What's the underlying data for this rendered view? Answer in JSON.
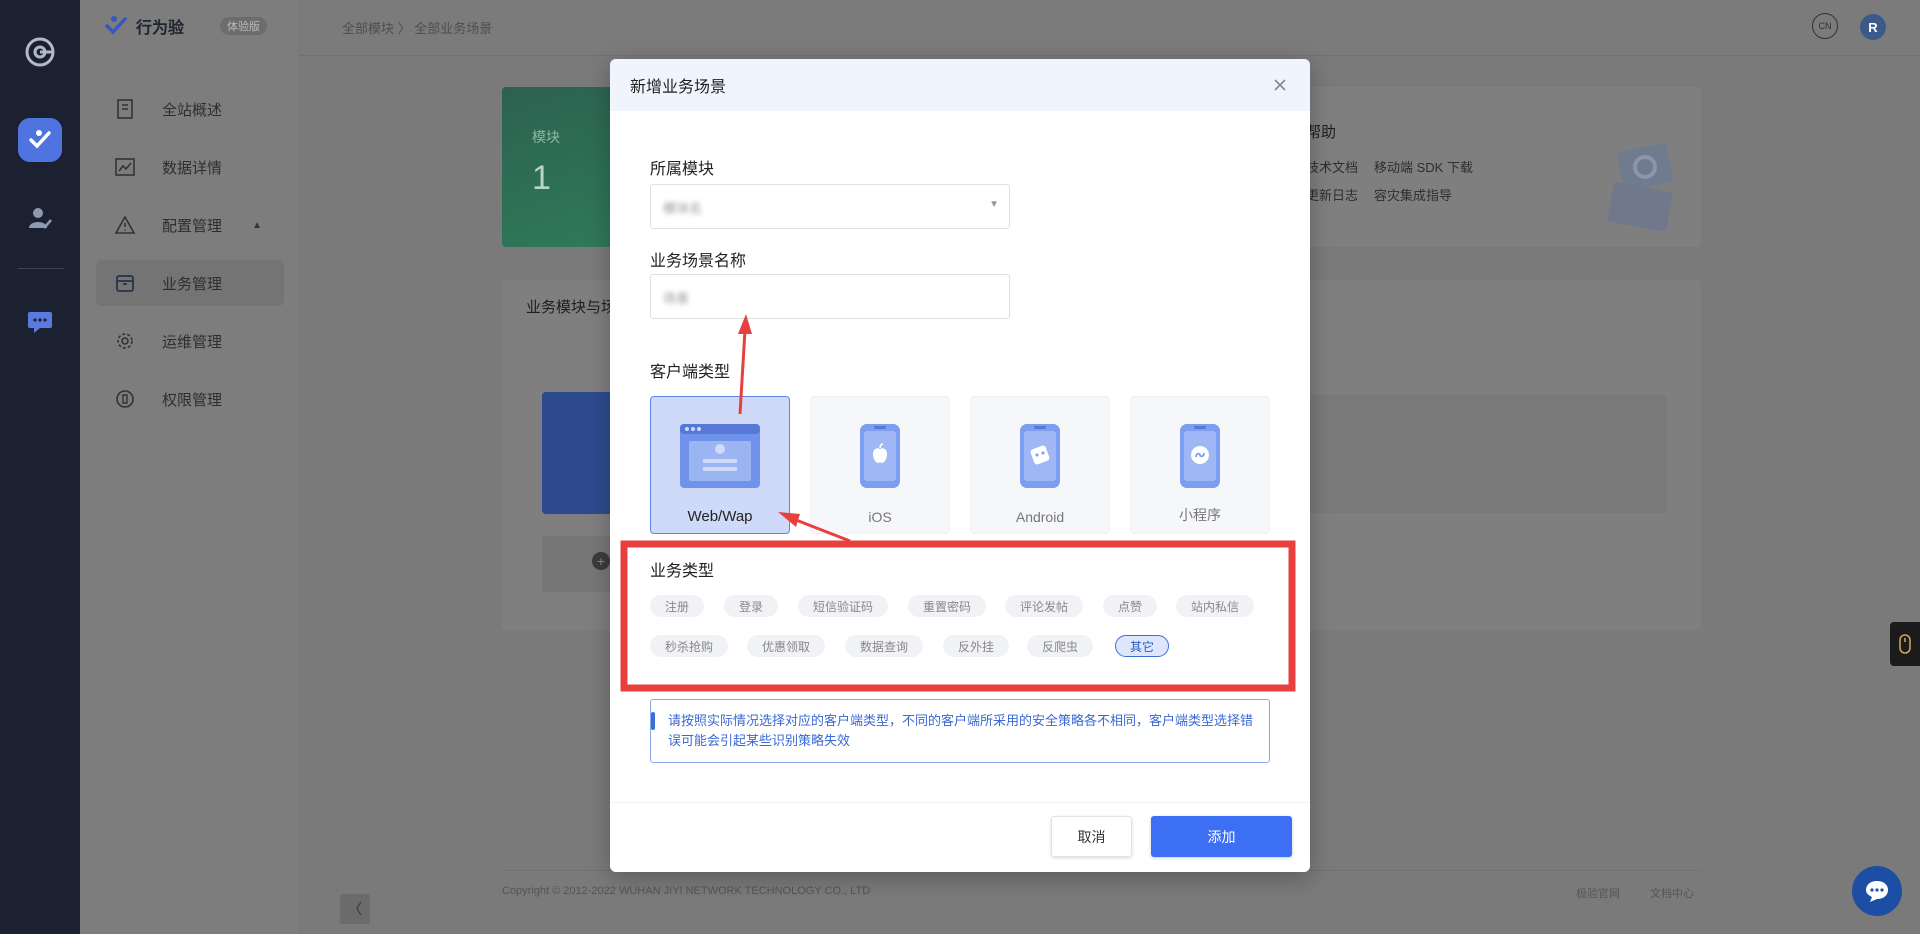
{
  "app": {
    "brand_name": "行为验",
    "brand_tag": "体验版",
    "breadcrumb": "全部模块 〉 全部业务场景",
    "top_help_label": "CN",
    "avatar_initial": "R"
  },
  "sidebar": {
    "items": [
      {
        "label": "全站概述",
        "icon": "document-icon"
      },
      {
        "label": "数据详情",
        "icon": "chart-icon"
      },
      {
        "label": "配置管理",
        "icon": "warning-icon"
      },
      {
        "label": "业务管理",
        "icon": "archive-icon"
      },
      {
        "label": "运维管理",
        "icon": "gear-icon"
      },
      {
        "label": "权限管理",
        "icon": "shield-icon"
      }
    ]
  },
  "background": {
    "green_card_label": "模块",
    "green_card_value": "1",
    "help_title": "帮助",
    "help_links": [
      "技术文档",
      "移动端 SDK 下载",
      "更新日志",
      "容灾集成指导"
    ],
    "main_title": "业务模块与场",
    "footer_copyright": "Copyright © 2012-2022 WUHAN JIYI NETWORK TECHNOLOGY CO., LTD",
    "footer_links": [
      "极验官网",
      "文档中心"
    ]
  },
  "modal": {
    "title": "新增业务场景",
    "module_label": "所属模块",
    "module_value": "模块名",
    "scene_name_label": "业务场景名称",
    "scene_name_value": "场景",
    "client_type_label": "客户端类型",
    "client_types": [
      {
        "label": "Web/Wap",
        "selected": true
      },
      {
        "label": "iOS",
        "selected": false
      },
      {
        "label": "Android",
        "selected": false
      },
      {
        "label": "小程序",
        "selected": false
      }
    ],
    "business_type_label": "业务类型",
    "business_types_row1": [
      "注册",
      "登录",
      "短信验证码",
      "重置密码",
      "评论发帖",
      "点赞",
      "站内私信"
    ],
    "business_types_row2": [
      "秒杀抢购",
      "优惠领取",
      "数据查询",
      "反外挂",
      "反爬虫",
      "其它"
    ],
    "selected_business_type": "其它",
    "info_text": "请按照实际情况选择对应的客户端类型，不同的客户端所采用的安全策略各不相同，客户端类型选择错误可能会引起某些识别策略失效",
    "cancel_label": "取消",
    "add_label": "添加"
  },
  "colors": {
    "primary": "#3c6ff3",
    "annotation": "#e8403f",
    "selected_bg": "#cfdaf8"
  }
}
